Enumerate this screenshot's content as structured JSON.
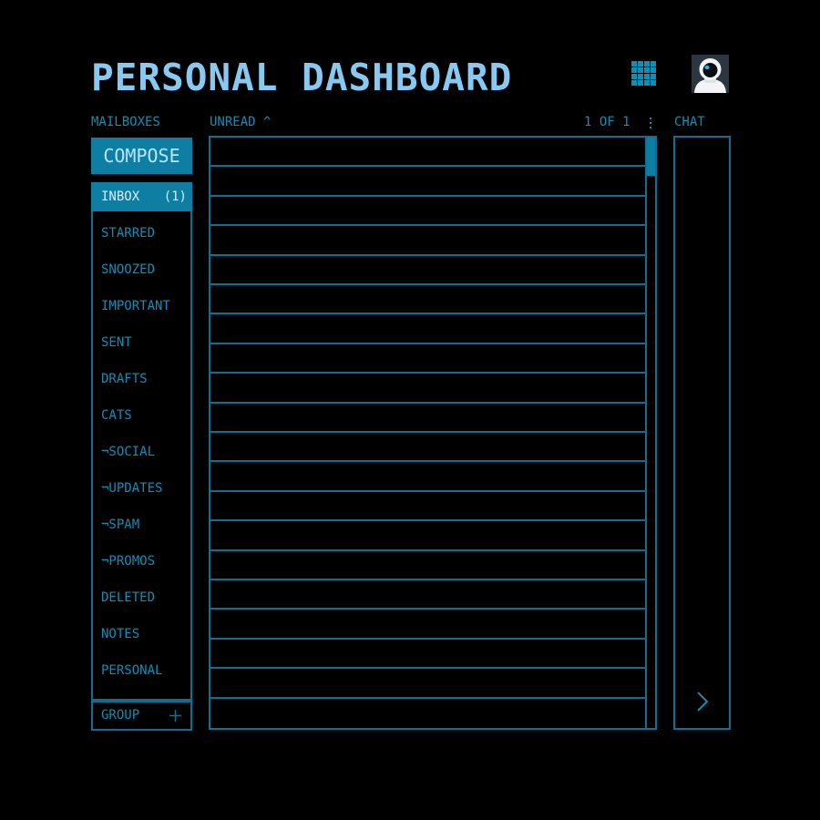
{
  "header": {
    "title": "PERSONAL DASHBOARD",
    "apps_icon": "grid-icon",
    "avatar_icon": "astronaut-avatar"
  },
  "mailboxes": {
    "label": "MAILBOXES",
    "compose_label": "COMPOSE",
    "items": [
      {
        "label": "INBOX",
        "count": "(1)",
        "active": true
      },
      {
        "label": "STARRED",
        "count": ""
      },
      {
        "label": "SNOOZED",
        "count": ""
      },
      {
        "label": "IMPORTANT",
        "count": ""
      },
      {
        "label": "SENT",
        "count": ""
      },
      {
        "label": "DRAFTS",
        "count": ""
      },
      {
        "label": "CATS",
        "count": ""
      },
      {
        "label": "¬SOCIAL",
        "count": ""
      },
      {
        "label": "¬UPDATES",
        "count": ""
      },
      {
        "label": "¬SPAM",
        "count": ""
      },
      {
        "label": "¬PROMOS",
        "count": ""
      },
      {
        "label": "DELETED",
        "count": ""
      },
      {
        "label": "NOTES",
        "count": ""
      },
      {
        "label": "PERSONAL",
        "count": ""
      }
    ],
    "group_label": "GROUP",
    "group_icon": "plus-icon"
  },
  "messages": {
    "sort_label": "UNREAD ^",
    "pagination": "1 OF 1",
    "menu_icon": "kebab-icon",
    "row_count": 20
  },
  "chat": {
    "label": "CHAT",
    "expand_icon": "chevron-right-icon"
  },
  "colors": {
    "background": "#000000",
    "title": "#87c9f0",
    "accent": "#0e7fa3",
    "border": "#0e6f91",
    "text": "#1a8ab0"
  }
}
